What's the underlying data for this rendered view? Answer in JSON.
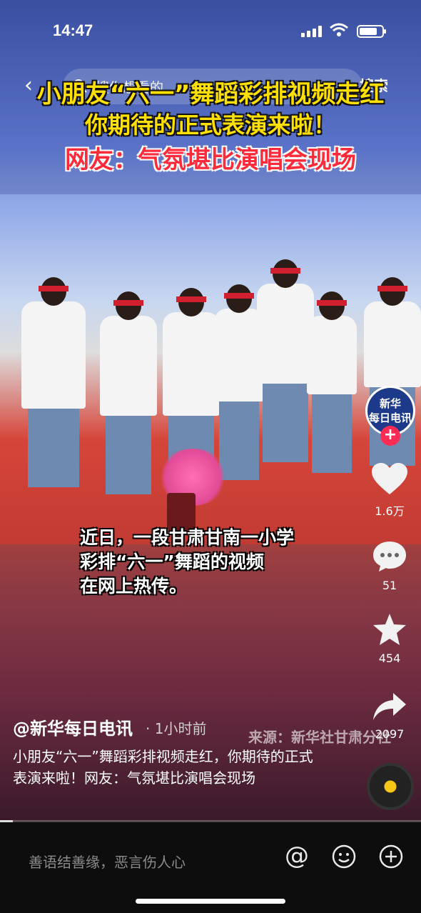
{
  "status_bar": {
    "time": "14:47"
  },
  "search": {
    "placeholder": "搜你想看的",
    "button_label": "搜索"
  },
  "video": {
    "title_line_1": "小朋友“六一”舞蹈彩排视频走红",
    "title_line_2": "你期待的正式表演来啦！",
    "title_line_3": "网友：气氛堪比演唱会现场",
    "caption_lines": [
      "近日，一段甘肃甘南一小学",
      "彩排“六一”舞蹈的视频",
      "在网上热传。"
    ],
    "source_watermark": "来源：新华社甘肃分社",
    "progress": 0.03
  },
  "rail": {
    "avatar_text": "新华\n每日电讯",
    "likes": "1.6万",
    "comments": "51",
    "favorites": "454",
    "shares": "2097"
  },
  "post": {
    "author": "@新华每日电讯",
    "time": "· 1小时前",
    "description": "小朋友“六一”舞蹈彩排视频走红，你期待的正式表演来啦！网友：气氛堪比演唱会现场"
  },
  "comment_bar": {
    "placeholder": "善语结善缘，恶言伤人心"
  },
  "icons": {
    "back": "back-icon",
    "search": "search-icon",
    "like": "heart-icon",
    "comment": "comment-icon",
    "favorite": "star-icon",
    "share": "share-icon",
    "mention": "at-icon",
    "emoji": "emoji-icon",
    "add": "plus-icon"
  }
}
